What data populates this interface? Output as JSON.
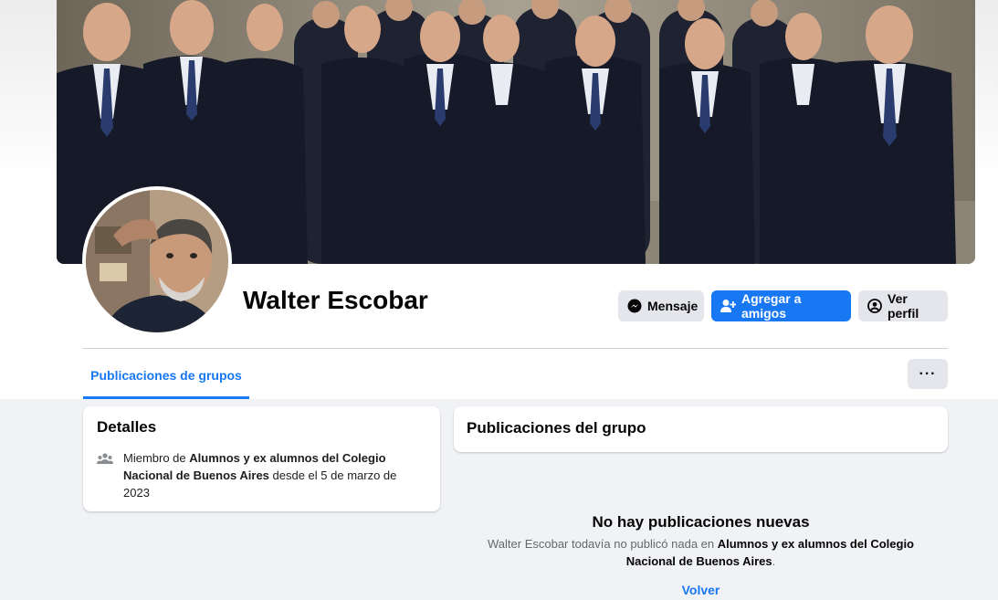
{
  "profile": {
    "name": "Walter Escobar"
  },
  "actions": {
    "message_label": "Mensaje",
    "add_friend_label": "Agregar a amigos",
    "view_profile_label": "Ver perfil",
    "more_label": "···"
  },
  "tabs": [
    {
      "label": "Publicaciones de grupos",
      "active": true
    }
  ],
  "details": {
    "title": "Detalles",
    "membership_prefix": "Miembro de ",
    "group_name": "Alumnos y ex alumnos del Colegio Nacional de Buenos Aires",
    "membership_suffix": " desde el 5 de marzo de 2023"
  },
  "group_posts": {
    "title": "Publicaciones del grupo",
    "empty_title": "No hay publicaciones nuevas",
    "empty_prefix": "Walter Escobar todavía no publicó nada en ",
    "group_name": "Alumnos y ex alumnos del Colegio Nacional de Buenos Aires",
    "empty_suffix": ".",
    "back_label": "Volver"
  },
  "colors": {
    "accent": "#1877f2",
    "button_grey": "#e4e6eb",
    "background": "#f0f2f5",
    "secondary_text": "#65676b"
  },
  "icons": {
    "message": "messenger-icon",
    "add_friend": "add-friend-icon",
    "view_profile": "user-circle-icon",
    "members": "people-icon"
  }
}
